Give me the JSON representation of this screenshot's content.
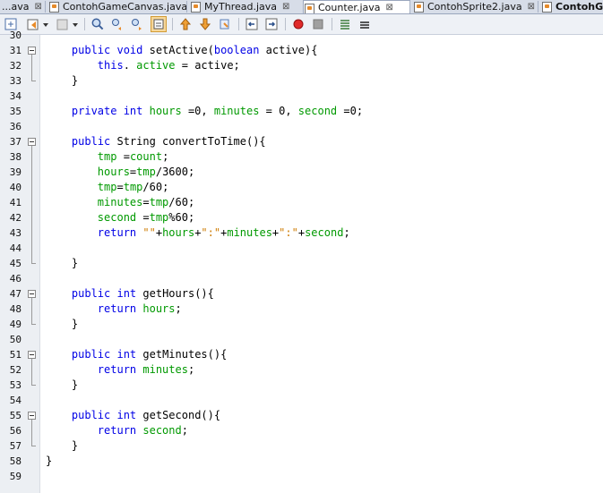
{
  "tabs": [
    {
      "label": "...ava",
      "close": "⊠",
      "active": false
    },
    {
      "label": "ContohGameCanvas.java",
      "close": "⊠",
      "active": false
    },
    {
      "label": "MyThread.java",
      "close": "⊠",
      "active": false
    },
    {
      "label": "Counter.java",
      "close": "⊠",
      "active": true
    },
    {
      "label": "ContohSprite2.java",
      "close": "⊠",
      "active": false
    },
    {
      "label": "ContohG",
      "close": "",
      "active": false
    }
  ],
  "toolbar": {
    "icons": [
      "source-history-icon",
      "back-icon",
      "dropdown-arrow-icon",
      "forward-icon",
      "search-icon",
      "find-previous-icon",
      "find-next-icon",
      "toggle-highlight-icon",
      "previous-bookmark-icon",
      "next-bookmark-icon",
      "toggle-bookmark-icon",
      "shift-left-icon",
      "shift-right-icon",
      "start-macro-icon",
      "stop-macro-icon",
      "comment-icon",
      "uncomment-icon"
    ]
  },
  "editor": {
    "first_line_number": "30",
    "lines": [
      {
        "n": "31",
        "tokens": [
          {
            "t": "    "
          },
          {
            "t": "public void ",
            "c": "kw"
          },
          {
            "t": "setActive("
          },
          {
            "t": "boolean ",
            "c": "kw"
          },
          {
            "t": "active){"
          }
        ]
      },
      {
        "n": "32",
        "tokens": [
          {
            "t": "        "
          },
          {
            "t": "this",
            "c": "kw"
          },
          {
            "t": ". "
          },
          {
            "t": "active",
            "c": "fld"
          },
          {
            "t": " = active;"
          }
        ]
      },
      {
        "n": "33",
        "tokens": [
          {
            "t": "    }"
          }
        ]
      },
      {
        "n": "34",
        "tokens": []
      },
      {
        "n": "35",
        "tokens": [
          {
            "t": "    "
          },
          {
            "t": "private int ",
            "c": "kw"
          },
          {
            "t": "hours",
            "c": "fld"
          },
          {
            "t": " =0, "
          },
          {
            "t": "minutes",
            "c": "fld"
          },
          {
            "t": " = 0, "
          },
          {
            "t": "second",
            "c": "fld"
          },
          {
            "t": " =0;"
          }
        ]
      },
      {
        "n": "36",
        "tokens": []
      },
      {
        "n": "37",
        "tokens": [
          {
            "t": "    "
          },
          {
            "t": "public ",
            "c": "kw"
          },
          {
            "t": "String convertToTime(){"
          }
        ]
      },
      {
        "n": "38",
        "tokens": [
          {
            "t": "        "
          },
          {
            "t": "tmp",
            "c": "fld"
          },
          {
            "t": " ="
          },
          {
            "t": "count",
            "c": "fld"
          },
          {
            "t": ";"
          }
        ]
      },
      {
        "n": "39",
        "tokens": [
          {
            "t": "        "
          },
          {
            "t": "hours",
            "c": "fld"
          },
          {
            "t": "="
          },
          {
            "t": "tmp",
            "c": "fld"
          },
          {
            "t": "/3600;"
          }
        ]
      },
      {
        "n": "40",
        "tokens": [
          {
            "t": "        "
          },
          {
            "t": "tmp",
            "c": "fld"
          },
          {
            "t": "="
          },
          {
            "t": "tmp",
            "c": "fld"
          },
          {
            "t": "/60;"
          }
        ]
      },
      {
        "n": "41",
        "tokens": [
          {
            "t": "        "
          },
          {
            "t": "minutes",
            "c": "fld"
          },
          {
            "t": "="
          },
          {
            "t": "tmp",
            "c": "fld"
          },
          {
            "t": "/60;"
          }
        ]
      },
      {
        "n": "42",
        "tokens": [
          {
            "t": "        "
          },
          {
            "t": "second",
            "c": "fld"
          },
          {
            "t": " ="
          },
          {
            "t": "tmp",
            "c": "fld"
          },
          {
            "t": "%60;"
          }
        ]
      },
      {
        "n": "43",
        "tokens": [
          {
            "t": "        "
          },
          {
            "t": "return ",
            "c": "kw"
          },
          {
            "t": "\"\"",
            "c": "str"
          },
          {
            "t": "+"
          },
          {
            "t": "hours",
            "c": "fld"
          },
          {
            "t": "+"
          },
          {
            "t": "\":\"",
            "c": "str"
          },
          {
            "t": "+"
          },
          {
            "t": "minutes",
            "c": "fld"
          },
          {
            "t": "+"
          },
          {
            "t": "\":\"",
            "c": "str"
          },
          {
            "t": "+"
          },
          {
            "t": "second",
            "c": "fld"
          },
          {
            "t": ";"
          }
        ]
      },
      {
        "n": "44",
        "tokens": []
      },
      {
        "n": "45",
        "tokens": [
          {
            "t": "    }"
          }
        ]
      },
      {
        "n": "46",
        "tokens": []
      },
      {
        "n": "47",
        "tokens": [
          {
            "t": "    "
          },
          {
            "t": "public int ",
            "c": "kw"
          },
          {
            "t": "getHours(){"
          }
        ]
      },
      {
        "n": "48",
        "tokens": [
          {
            "t": "        "
          },
          {
            "t": "return ",
            "c": "kw"
          },
          {
            "t": "hours",
            "c": "fld"
          },
          {
            "t": ";"
          }
        ]
      },
      {
        "n": "49",
        "tokens": [
          {
            "t": "    }"
          }
        ]
      },
      {
        "n": "50",
        "tokens": []
      },
      {
        "n": "51",
        "tokens": [
          {
            "t": "    "
          },
          {
            "t": "public int ",
            "c": "kw"
          },
          {
            "t": "getMinutes(){"
          }
        ]
      },
      {
        "n": "52",
        "tokens": [
          {
            "t": "        "
          },
          {
            "t": "return ",
            "c": "kw"
          },
          {
            "t": "minutes",
            "c": "fld"
          },
          {
            "t": ";"
          }
        ]
      },
      {
        "n": "53",
        "tokens": [
          {
            "t": "    }"
          }
        ]
      },
      {
        "n": "54",
        "tokens": []
      },
      {
        "n": "55",
        "tokens": [
          {
            "t": "    "
          },
          {
            "t": "public int ",
            "c": "kw"
          },
          {
            "t": "getSecond(){"
          }
        ]
      },
      {
        "n": "56",
        "tokens": [
          {
            "t": "        "
          },
          {
            "t": "return ",
            "c": "kw"
          },
          {
            "t": "second",
            "c": "fld"
          },
          {
            "t": ";"
          }
        ]
      },
      {
        "n": "57",
        "tokens": [
          {
            "t": "    }"
          }
        ]
      },
      {
        "n": "58",
        "tokens": [
          {
            "t": "}"
          }
        ]
      },
      {
        "n": "59",
        "tokens": []
      }
    ],
    "fold_lines": [
      "31",
      "37",
      "47",
      "51",
      "55"
    ]
  },
  "colors": {
    "keyword": "#0000e6",
    "field": "#009900",
    "string": "#ce7b00",
    "active_tab": "#ffffff",
    "tab_bar": "#d7dde8"
  }
}
